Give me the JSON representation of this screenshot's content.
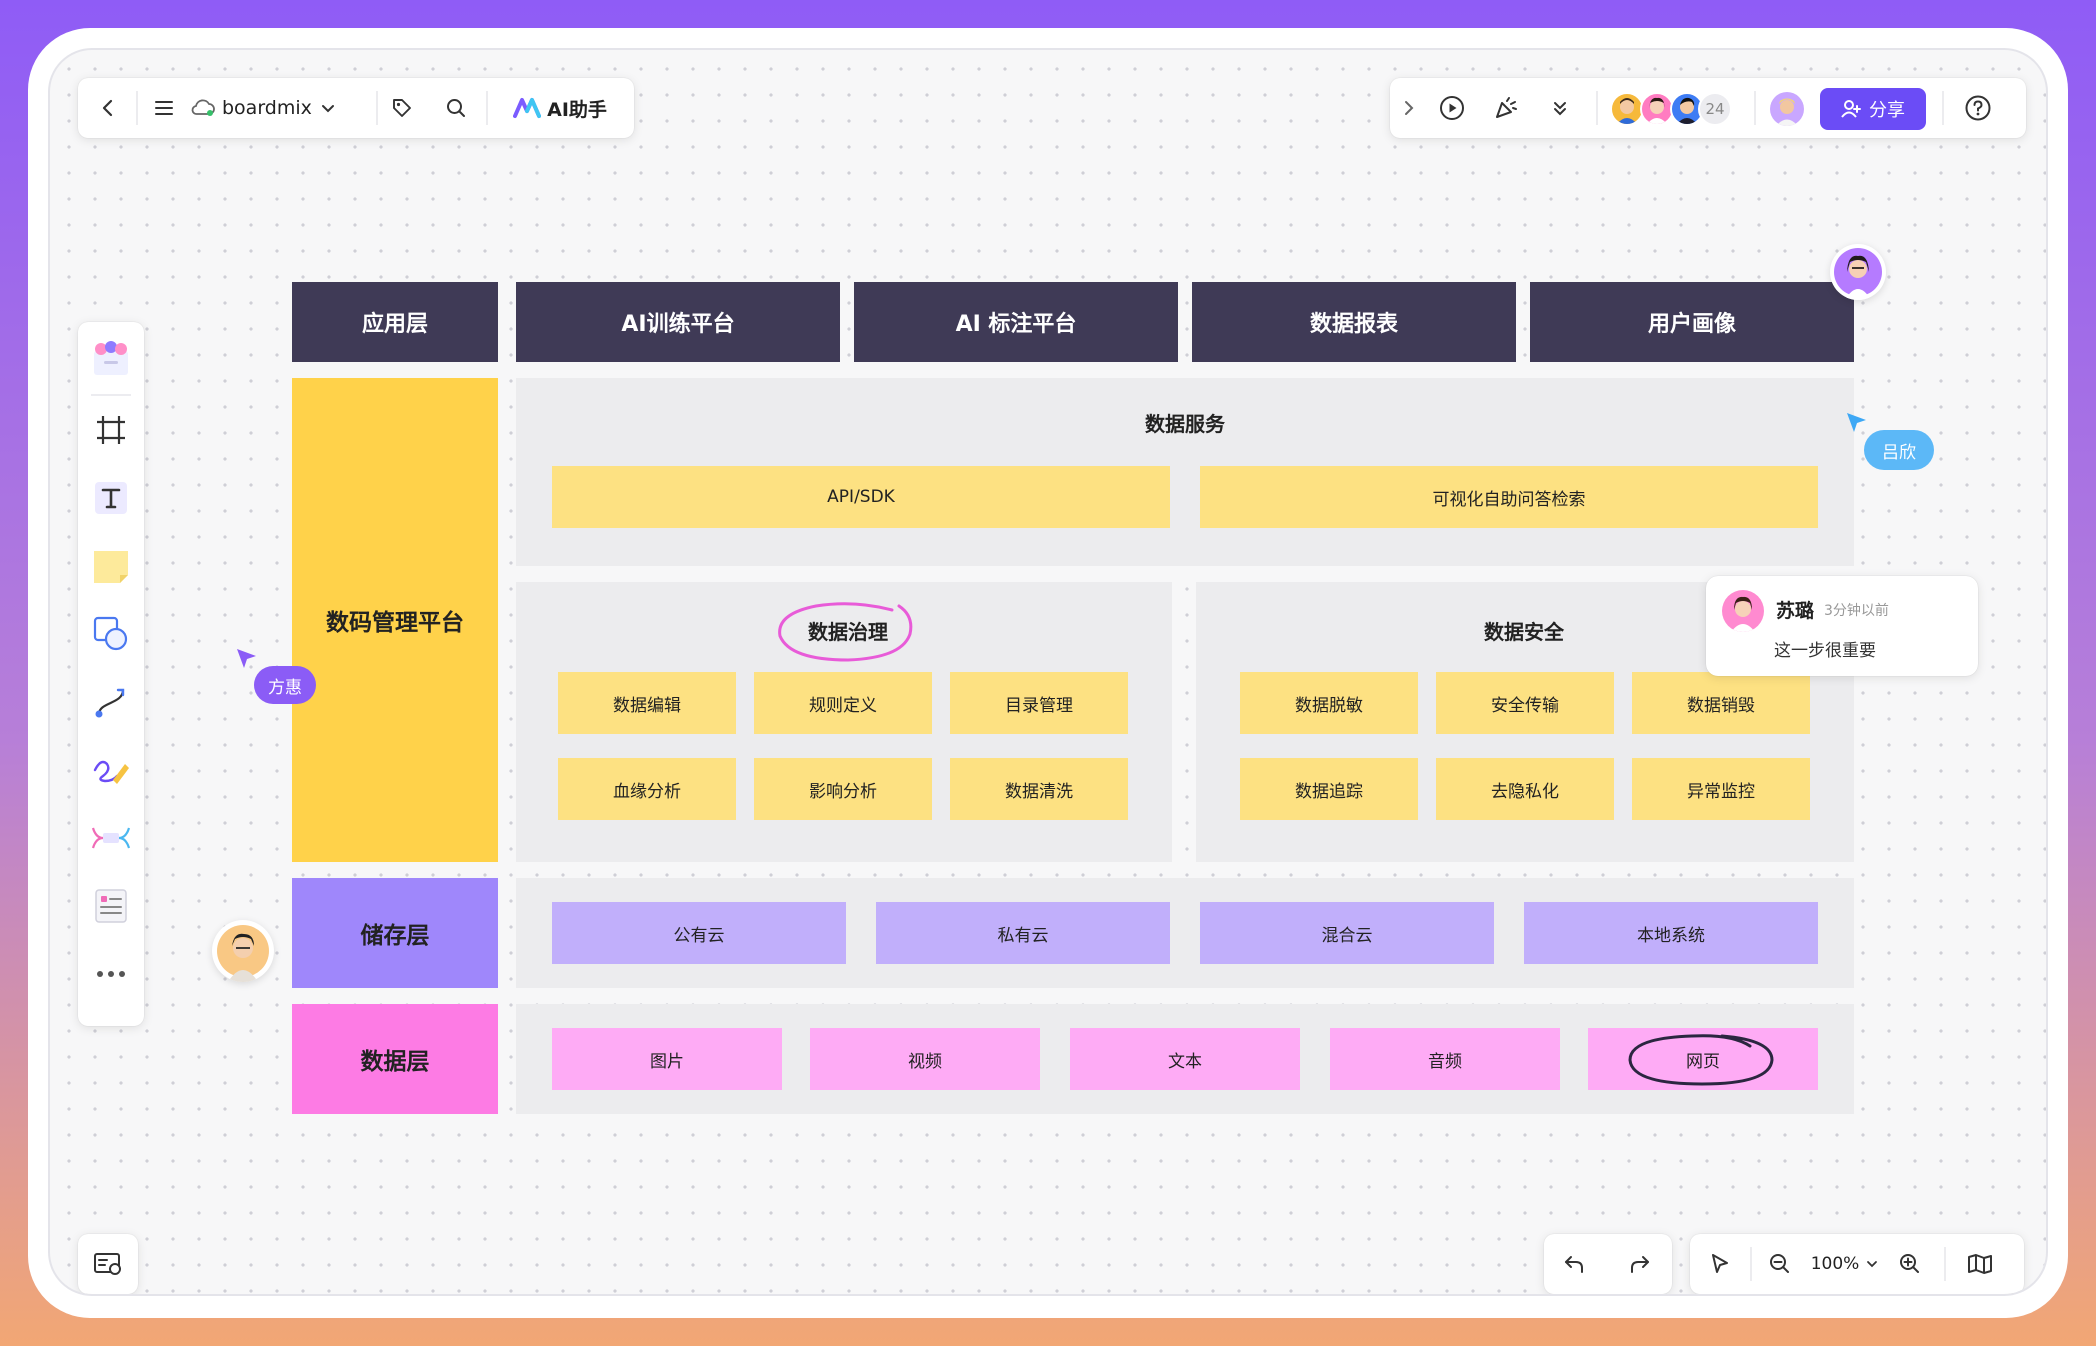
{
  "app": {
    "workspace_name": "boardmix",
    "ai_button_label": "AI助手",
    "collaborator_count": "24",
    "share_label": "分享",
    "zoom_level": "100%",
    "accent_color": "#6b4cf6"
  },
  "diagram": {
    "header_row": [
      "应用层",
      "AI训练平台",
      "AI 标注平台",
      "数据报表",
      "用户画像"
    ],
    "platform_label": "数码管理平台",
    "data_service": {
      "title": "数据服务",
      "items": [
        "API/SDK",
        "可视化自助问答检索"
      ]
    },
    "data_governance": {
      "title": "数据治理",
      "items": [
        "数据编辑",
        "规则定义",
        "目录管理",
        "血缘分析",
        "影响分析",
        "数据清洗"
      ]
    },
    "data_security": {
      "title": "数据安全",
      "items": [
        "数据脱敏",
        "安全传输",
        "数据销毁",
        "数据追踪",
        "去隐私化",
        "异常监控"
      ]
    },
    "storage": {
      "label": "储存层",
      "items": [
        "公有云",
        "私有云",
        "混合云",
        "本地系统"
      ]
    },
    "data_layer": {
      "label": "数据层",
      "items": [
        "图片",
        "视频",
        "文本",
        "音频",
        "网页"
      ]
    }
  },
  "collaborators": {
    "cursor_left_name": "方惠",
    "cursor_right_name": "吕欣"
  },
  "comment": {
    "author": "苏璐",
    "time": "3分钟以前",
    "text": "这一步很重要"
  }
}
